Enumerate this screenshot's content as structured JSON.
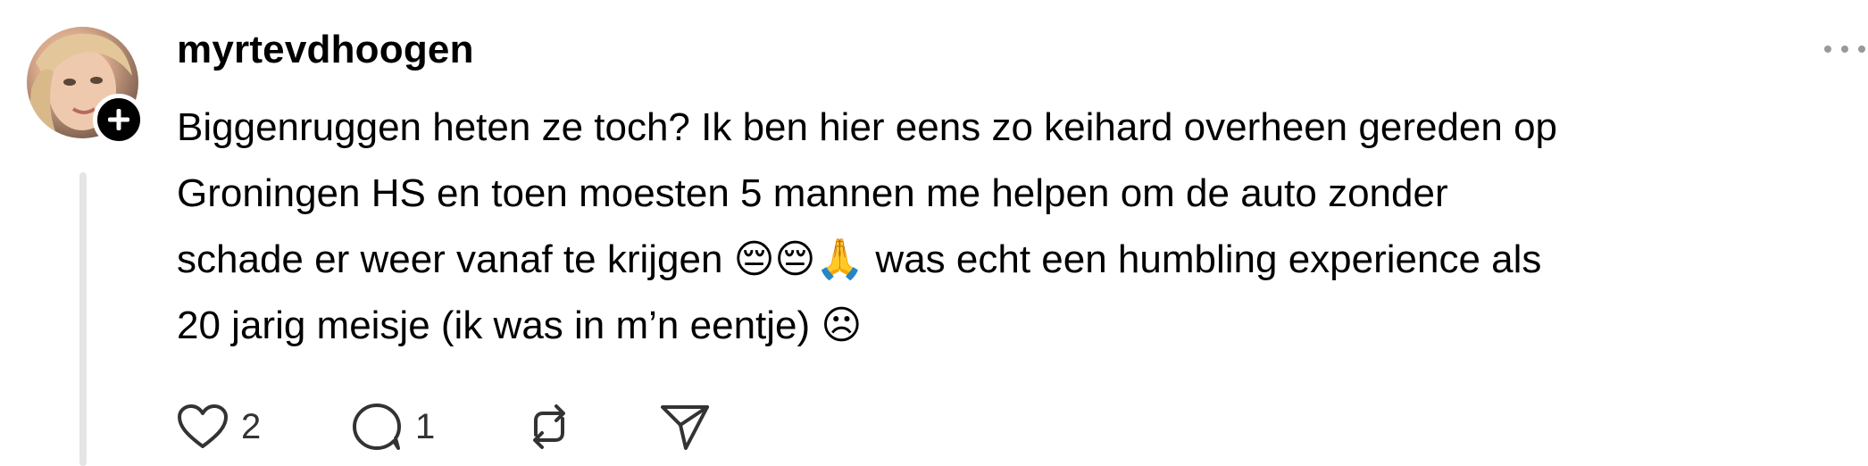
{
  "post": {
    "username": "myrtevdhoogen",
    "text_lines": [
      "Biggenruggen heten ze toch? Ik ben hier eens zo keihard overheen gereden op",
      "Groningen HS en toen moesten 5 mannen me helpen om de auto zonder",
      "schade er weer vanaf te krijgen 😔😔🙏 was echt een humbling experience als",
      "20 jarig meisje (ik was in m’n eentje) ☹"
    ]
  },
  "actions": {
    "like_count": "2",
    "reply_count": "1"
  },
  "icons": {
    "avatar": "profile-photo",
    "follow": "plus-icon",
    "more": "more-dots-icon",
    "like": "heart-icon",
    "reply": "comment-bubble-icon",
    "repost": "repost-icon",
    "share": "send-icon"
  },
  "colors": {
    "text": "#000000",
    "secondary_text": "#333333",
    "thread_line": "#e5e5e5",
    "more_dots": "#999999"
  }
}
